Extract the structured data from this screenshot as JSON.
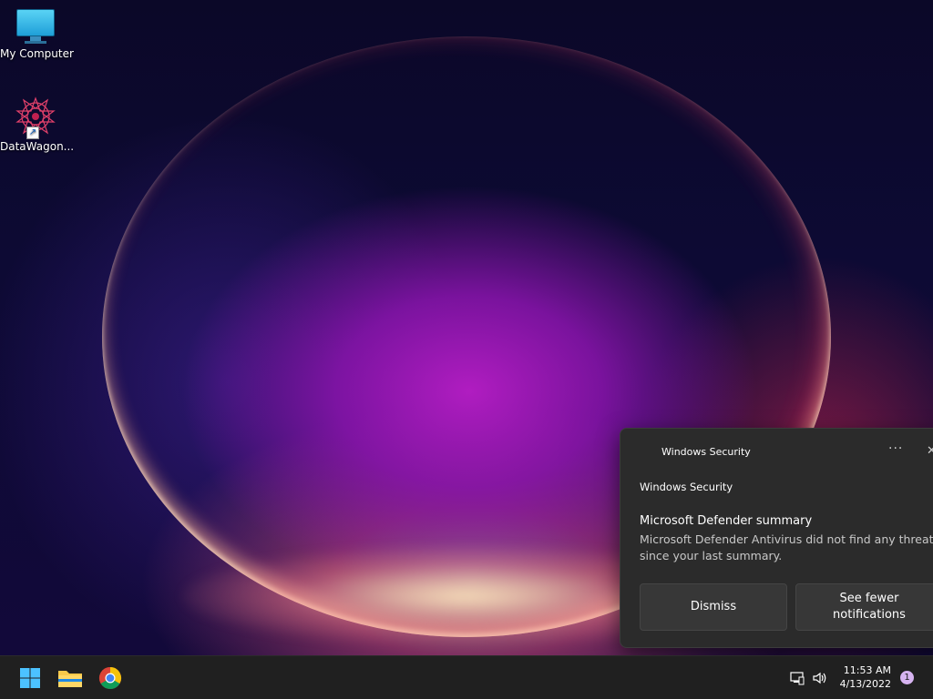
{
  "desktop": {
    "icons": [
      {
        "label": "My Computer",
        "icon": "monitor-icon"
      },
      {
        "label": "DataWagon...",
        "icon": "star-logo-icon"
      }
    ]
  },
  "taskbar": {
    "apps": [
      {
        "name": "Start",
        "icon": "windows-start-icon"
      },
      {
        "name": "File Explorer",
        "icon": "folder-icon"
      },
      {
        "name": "Google Chrome",
        "icon": "chrome-icon"
      }
    ],
    "tray": {
      "network_icon": "network-icon",
      "volume_icon": "volume-icon",
      "time": "11:53 AM",
      "date": "4/13/2022",
      "notification_count": "1"
    }
  },
  "toast": {
    "app_name": "Windows Security",
    "more_label": "···",
    "close_label": "✕",
    "source": "Windows Security",
    "title": "Microsoft Defender summary",
    "body_line1": "Microsoft Defender Antivirus did not find any threats",
    "body_line2": "since your last summary.",
    "buttons": {
      "dismiss": "Dismiss",
      "see_fewer": "See fewer notifications"
    }
  },
  "colors": {
    "taskbar": "#202020",
    "toast_bg": "#2b2b2b",
    "accent": "#0078d4"
  }
}
